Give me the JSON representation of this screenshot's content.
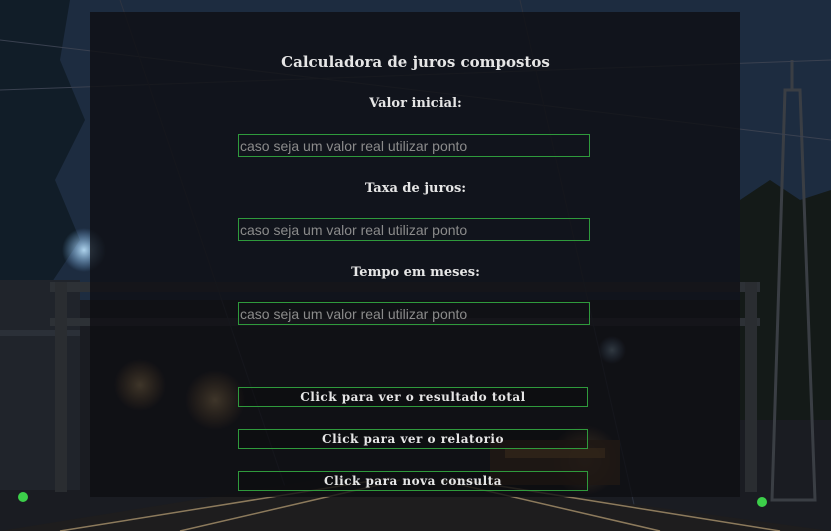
{
  "form": {
    "title": "Calculadora de juros compostos",
    "fields": [
      {
        "label": "Valor inicial:",
        "placeholder": "caso seja um valor real utilizar ponto",
        "value": ""
      },
      {
        "label": "Taxa de juros:",
        "placeholder": "caso seja um valor real utilizar ponto",
        "value": ""
      },
      {
        "label": "Tempo em meses:",
        "placeholder": "caso seja um valor real utilizar ponto",
        "value": ""
      }
    ],
    "buttons": [
      {
        "label": "Click para ver o resultado total"
      },
      {
        "label": "Click para ver o relatorio"
      },
      {
        "label": "Click para nova consulta"
      }
    ]
  },
  "colors": {
    "panel": "#0e0e12",
    "accent_border": "#2f9a3c",
    "text": "#e6e6e6",
    "placeholder": "#8b8b8b"
  }
}
